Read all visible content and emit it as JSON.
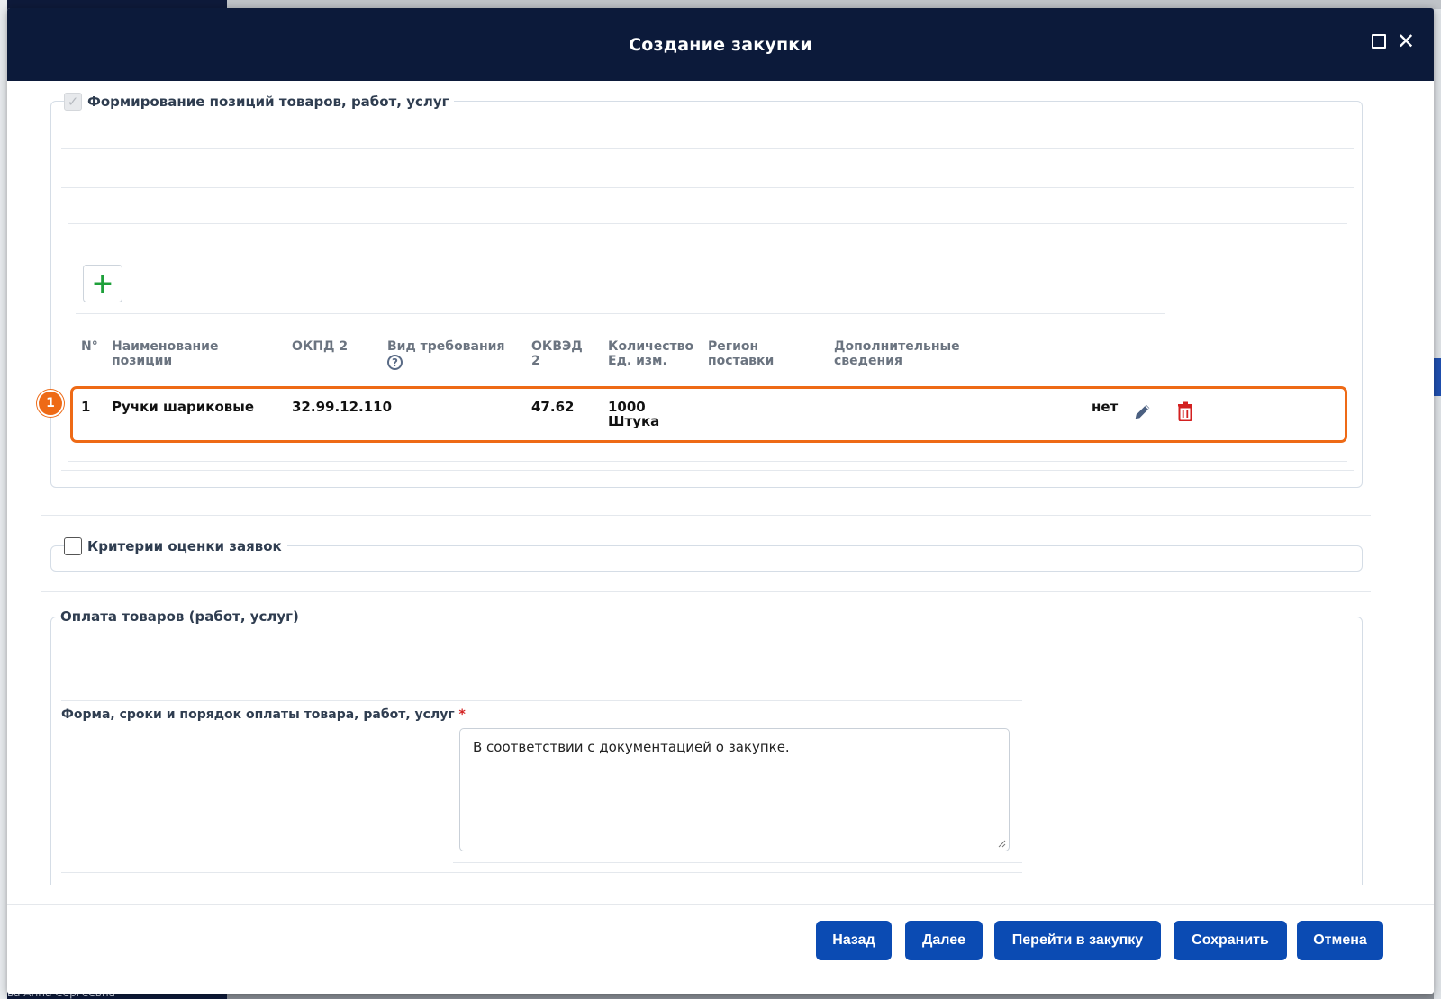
{
  "modal": {
    "title": "Создание закупки"
  },
  "background": {
    "bottom_name": "ва Анна Сергеевна"
  },
  "section_positions": {
    "legend": "Формирование позиций товаров, работ, услуг",
    "checked": true,
    "columns": {
      "num": "N°",
      "name": "Наименование позиции",
      "okpd": "ОКПД 2",
      "req_type": "Вид требования",
      "okved": "ОКВЭД 2",
      "qty": "Количество Ед. изм.",
      "region": "Регион поставки",
      "extra": "Дополнительные сведения"
    },
    "rows": [
      {
        "num": "1",
        "name": "Ручки шариковые",
        "okpd": "32.99.12.110",
        "okved": "47.62",
        "qty": "1000",
        "unit": "Штука",
        "extra": "нет"
      }
    ],
    "badge": "1"
  },
  "section_criteria": {
    "legend": "Критерии оценки заявок",
    "checked": false
  },
  "section_payment": {
    "legend": "Оплата товаров (работ, услуг)",
    "field_label": "Форма, сроки и порядок оплаты товара, работ, услуг",
    "required_mark": "*",
    "field_value": "В соответствии с документацией о закупке."
  },
  "footer": {
    "back": "Назад",
    "next": "Далее",
    "goto": "Перейти в закупку",
    "save": "Сохранить",
    "cancel": "Отмена"
  },
  "colors": {
    "header_bg": "#0c1a3a",
    "primary_button": "#0b4bb3",
    "highlight": "#ee6a16",
    "add_icon": "#1ea03a",
    "delete_icon": "#d32020",
    "edit_icon": "#4a5f80"
  }
}
